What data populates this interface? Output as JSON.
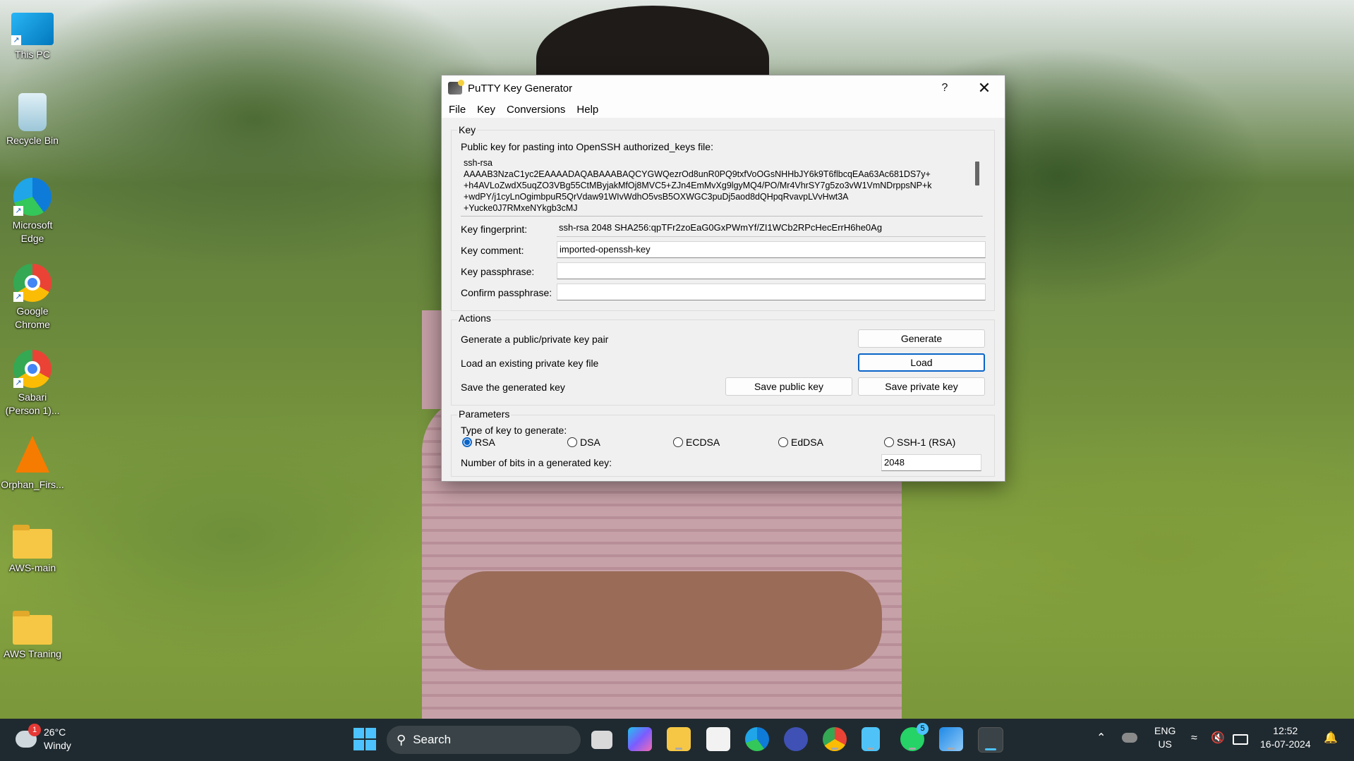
{
  "desktop": {
    "icons": [
      {
        "label": "This PC"
      },
      {
        "label": "Recycle Bin"
      },
      {
        "label": "Microsoft Edge"
      },
      {
        "label": "Google Chrome"
      },
      {
        "label": "Sabari (Person 1)..."
      },
      {
        "label": "Orphan_Firs..."
      },
      {
        "label": "AWS-main"
      },
      {
        "label": "AWS Traning"
      }
    ]
  },
  "window": {
    "title": "PuTTY Key Generator",
    "help_button": "?",
    "close_button": "✕",
    "menu": [
      "File",
      "Key",
      "Conversions",
      "Help"
    ],
    "key_group": {
      "label": "Key",
      "pubkey_label": "Public key for pasting into OpenSSH authorized_keys file:",
      "pubkey_lines": [
        "ssh-rsa",
        "AAAAB3NzaC1yc2EAAAADAQABAAABAQCYGWQezrOd8unR0PQ9txfVoOGsNHHbJY6k9T6flbcqEAa63Ac681DS7y+",
        "+h4AVLoZwdX5uqZO3VBg55CtMByjakMfOj8MVC5+ZJn4EmMvXg9lgyMQ4/PO/Mr4VhrSY7g5zo3vW1VmNDrppsNP+k",
        "+wdPY/j1cyLnOgimbpuR5QrVdaw91WIvWdhO5vsB5OXWGC3puDj5aod8dQHpqRvavpLVvHwt3A",
        "+Yucke0J7RMxeNYkgb3cMJ"
      ],
      "fingerprint_label": "Key fingerprint:",
      "fingerprint_value": "ssh-rsa 2048 SHA256:qpTFr2zoEaG0GxPWmYf/ZI1WCb2RPcHecErrH6he0Ag",
      "comment_label": "Key comment:",
      "comment_value": "imported-openssh-key",
      "passphrase_label": "Key passphrase:",
      "passphrase_value": "",
      "confirm_label": "Confirm passphrase:",
      "confirm_value": ""
    },
    "actions_group": {
      "label": "Actions",
      "generate_text": "Generate a public/private key pair",
      "generate_button": "Generate",
      "load_text": "Load an existing private key file",
      "load_button": "Load",
      "save_text": "Save the generated key",
      "save_public_button": "Save public key",
      "save_private_button": "Save private key"
    },
    "parameters_group": {
      "label": "Parameters",
      "type_label": "Type of key to generate:",
      "key_types": [
        {
          "label": "RSA",
          "selected": true
        },
        {
          "label": "DSA",
          "selected": false
        },
        {
          "label": "ECDSA",
          "selected": false
        },
        {
          "label": "EdDSA",
          "selected": false
        },
        {
          "label": "SSH-1 (RSA)",
          "selected": false
        }
      ],
      "bits_label": "Number of bits in a generated key:",
      "bits_value": "2048"
    }
  },
  "taskbar": {
    "weather_temp": "26°C",
    "weather_desc": "Windy",
    "weather_badge": "1",
    "search_label": "Search",
    "whatsapp_badge": "5",
    "lang_line1": "ENG",
    "lang_line2": "US",
    "time": "12:52",
    "date": "16-07-2024",
    "accent": "#4cc2ff"
  }
}
